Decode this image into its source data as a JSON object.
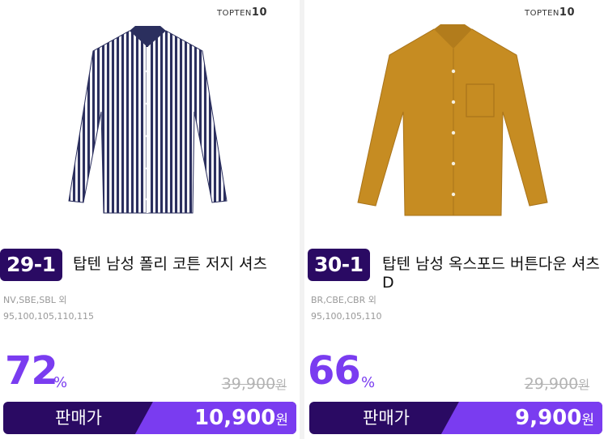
{
  "products": [
    {
      "brand_prefix": "TOPTEN",
      "brand_suffix": "10",
      "rank": "29-1",
      "title": "탑텐 남성 폴리 코튼 저지 셔츠",
      "colors": "NV,SBE,SBL 외",
      "sizes": "95,100,105,110,115",
      "discount": "72",
      "discount_unit": "%",
      "original_price": "39,900",
      "price_unit": "원",
      "price_label": "판매가",
      "sale_price": "10,900",
      "image_icon": "striped-shirt-image"
    },
    {
      "brand_prefix": "TOPTEN",
      "brand_suffix": "10",
      "rank": "30-1",
      "title": "탑텐 남성 옥스포드 버튼다운 셔츠 D",
      "colors": "BR,CBE,CBR 외",
      "sizes": "95,100,105,110",
      "discount": "66",
      "discount_unit": "%",
      "original_price": "29,900",
      "price_unit": "원",
      "price_label": "판매가",
      "sale_price": "9,900",
      "image_icon": "mustard-shirt-image"
    }
  ],
  "colors": {
    "accent_dark": "#2a0a63",
    "accent_purple": "#7a3cf0",
    "muted_text": "#999999"
  }
}
